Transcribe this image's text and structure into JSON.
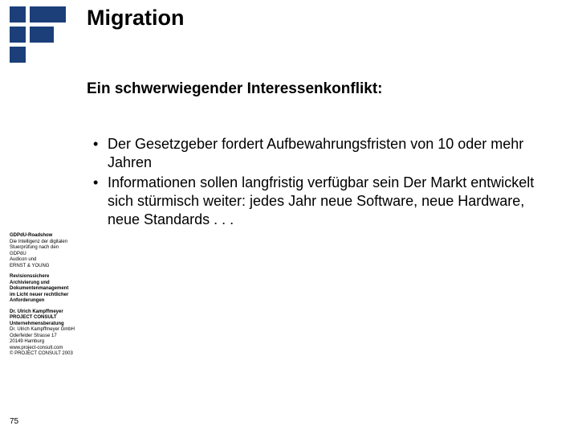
{
  "title": "Migration",
  "subtitle": "Ein schwerwiegender Interessenkonflikt:",
  "bullets": [
    "Der Gesetzgeber fordert Aufbewahrungsfristen von 10 oder mehr Jahren",
    "Informationen sollen langfristig verfügbar sein Der Markt entwickelt sich stürmisch weiter: jedes Jahr neue Software, neue Hardware, neue Standards . . ."
  ],
  "sidebar": {
    "block1": {
      "l1": "GDPdU-Roadshow",
      "l2": "Die Intelligenz der digitalen",
      "l3": "Stuerprüfung nach den",
      "l4": "GDPdU",
      "l5": "Audicon und",
      "l6": "ERNST & YOUNG"
    },
    "block2": {
      "l1": "Revisionssichere",
      "l2": "Archivierung und",
      "l3": "Dokumentenmanagement",
      "l4": "im Licht neuer rechtlicher",
      "l5": "Anforderungen"
    },
    "block3": {
      "l1": "Dr. Ulrich Kampffmeyer",
      "l2": "PROJECT  CONSULT",
      "l3": "Unternehmensberatung",
      "l4": "Dr. Ulrich Kampffmeyer GmbH",
      "l5": "Oderfelder Strasse 17",
      "l6": "20149 Hamburg",
      "l7": "www.project-consult.com",
      "l8": "© PROJECT CONSULT 2003"
    }
  },
  "slide_number": "75",
  "colors": {
    "brand": "#1c3f7a"
  }
}
